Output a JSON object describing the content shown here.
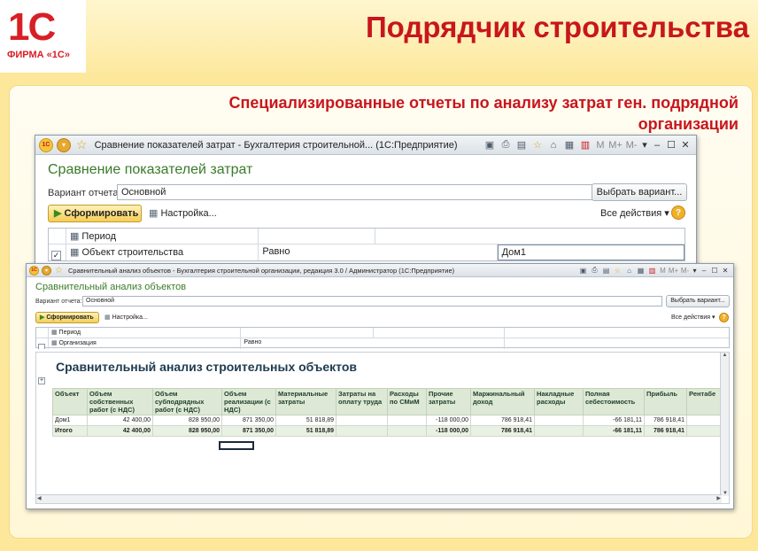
{
  "slide": {
    "logo_text": "1С",
    "logo_caption": "ФИРМА «1С»",
    "title": "Подрядчик строительства",
    "subtitle": "Специализированные отчеты по анализу затрат ген. подрядной организации"
  },
  "window1": {
    "title": "Сравнение показателей затрат - Бухгалтерия строительной... (1С:Предприятие)",
    "form_title": "Сравнение показателей затрат",
    "variant_label": "Вариант отчета:",
    "variant_value": "Основной",
    "choose_variant": "Выбрать вариант...",
    "generate": "Сформировать",
    "settings": "Настройка...",
    "all_actions": "Все действия",
    "help": "?",
    "ctrl_m": "M",
    "ctrl_mplus": "M+",
    "ctrl_mminus": "M-",
    "filters": [
      {
        "field": "Период",
        "condition": "",
        "value": "",
        "checked": false
      },
      {
        "field": "Объект строительства",
        "condition": "Равно",
        "value": "Дом1",
        "checked": true
      }
    ]
  },
  "window2": {
    "title": "Сравнительный анализ объектов - Бухгалтерия строительной организации, редакция 3.0 / Администратор (1С:Предприятие)",
    "form_title": "Сравнительный анализ объектов",
    "variant_label": "Вариант отчета:",
    "variant_value": "Основной",
    "choose_variant": "Выбрать вариант...",
    "generate": "Сформировать",
    "settings": "Настройка...",
    "all_actions": "Все действия",
    "help": "?",
    "ctrl_m": "M",
    "ctrl_mplus": "M+",
    "ctrl_mminus": "M-",
    "filters": [
      {
        "field": "Период",
        "condition": "",
        "value": ""
      },
      {
        "field": "Организация",
        "condition": "Равно",
        "value": ""
      }
    ],
    "report": {
      "title": "Сравнительный анализ строительных объектов",
      "columns": [
        "Объект",
        "Объем собственных работ (с НДС)",
        "Объем субподрядных работ (с НДС)",
        "Объем реализации (с НДС)",
        "Материальные затраты",
        "Затраты на оплату труда",
        "Расходы по СМиМ",
        "Прочие затраты",
        "Маржинальный доход",
        "Накладные расходы",
        "Полная себестоимость",
        "Прибыль",
        "Рентабе"
      ],
      "rows": [
        [
          "Дом1",
          "42 400,00",
          "828 950,00",
          "871 350,00",
          "51 818,89",
          "",
          "",
          "-118 000,00",
          "786 918,41",
          "",
          "-66 181,11",
          "786 918,41",
          ""
        ],
        [
          "Итого",
          "42 400,00",
          "828 950,00",
          "871 350,00",
          "51 818,89",
          "",
          "",
          "-118 000,00",
          "786 918,41",
          "",
          "-66 181,11",
          "786 918,41",
          ""
        ]
      ]
    }
  }
}
